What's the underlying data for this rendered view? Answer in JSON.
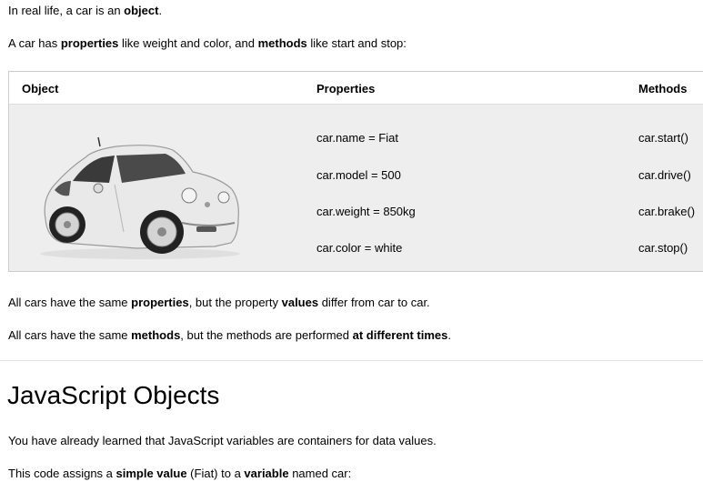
{
  "intro": {
    "p1": {
      "t1": "In real life, a car is an ",
      "b1": "object",
      "t2": "."
    },
    "p2": {
      "t1": "A car has ",
      "b1": "properties",
      "t2": " like weight and color, and ",
      "b2": "methods",
      "t3": " like start and stop:"
    }
  },
  "table": {
    "headers": {
      "object": "Object",
      "properties": "Properties",
      "methods": "Methods"
    },
    "properties": [
      "car.name = Fiat",
      "car.model = 500",
      "car.weight = 850kg",
      "car.color = white"
    ],
    "methods": [
      "car.start()",
      "car.drive()",
      "car.brake()",
      "car.stop()"
    ],
    "car_color": "#e9e9e9"
  },
  "after": {
    "p3": {
      "t1": "All cars have the same ",
      "b1": "properties",
      "t2": ", but the property ",
      "b2": "values",
      "t3": " differ from car to car."
    },
    "p4": {
      "t1": "All cars have the same ",
      "b1": "methods",
      "t2": ", but the methods are performed ",
      "b2": "at different times",
      "t3": "."
    }
  },
  "section": {
    "heading": "JavaScript Objects",
    "p5": {
      "t1": "You have already learned that JavaScript variables are containers for data values."
    },
    "p6": {
      "t1": "This code assigns a ",
      "b1": "simple value",
      "t2": " (Fiat) to a ",
      "b2": "variable",
      "t3": " named car:"
    }
  }
}
